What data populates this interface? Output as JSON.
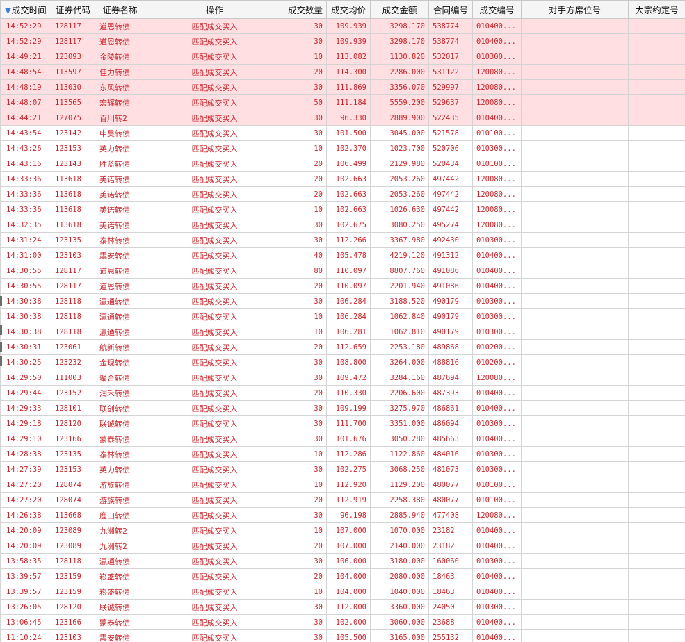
{
  "table": {
    "sorted_column_index": 0,
    "columns": [
      "成交时间",
      "证券代码",
      "证券名称",
      "操作",
      "成交数量",
      "成交均价",
      "成交金额",
      "合同编号",
      "成交编号",
      "对手方席位号",
      "大宗约定号"
    ],
    "rows": [
      {
        "time": "14:52:29",
        "code": "128117",
        "name": "道恩转债",
        "op": "匹配成交买入",
        "qty": "30",
        "price": "109.939",
        "amount": "3298.170",
        "contract": "538774",
        "trade_id": "010400...",
        "counterparty": "",
        "block": "",
        "highlight": true
      },
      {
        "time": "14:52:29",
        "code": "128117",
        "name": "道恩转债",
        "op": "匹配成交买入",
        "qty": "30",
        "price": "109.939",
        "amount": "3298.170",
        "contract": "538774",
        "trade_id": "010400...",
        "counterparty": "",
        "block": "",
        "highlight": true
      },
      {
        "time": "14:49:21",
        "code": "123093",
        "name": "金陵转债",
        "op": "匹配成交买入",
        "qty": "10",
        "price": "113.082",
        "amount": "1130.820",
        "contract": "532017",
        "trade_id": "010300...",
        "counterparty": "",
        "block": "",
        "highlight": true
      },
      {
        "time": "14:48:54",
        "code": "113597",
        "name": "佳力转债",
        "op": "匹配成交买入",
        "qty": "20",
        "price": "114.300",
        "amount": "2286.000",
        "contract": "531122",
        "trade_id": "120080...",
        "counterparty": "",
        "block": "",
        "highlight": true
      },
      {
        "time": "14:48:19",
        "code": "113030",
        "name": "东风转债",
        "op": "匹配成交买入",
        "qty": "30",
        "price": "111.869",
        "amount": "3356.070",
        "contract": "529997",
        "trade_id": "120080...",
        "counterparty": "",
        "block": "",
        "highlight": true
      },
      {
        "time": "14:48:07",
        "code": "113565",
        "name": "宏辉转债",
        "op": "匹配成交买入",
        "qty": "50",
        "price": "111.184",
        "amount": "5559.200",
        "contract": "529637",
        "trade_id": "120080...",
        "counterparty": "",
        "block": "",
        "highlight": true
      },
      {
        "time": "14:44:21",
        "code": "127075",
        "name": "百川转2",
        "op": "匹配成交买入",
        "qty": "30",
        "price": "96.330",
        "amount": "2889.900",
        "contract": "522435",
        "trade_id": "010400...",
        "counterparty": "",
        "block": "",
        "highlight": true
      },
      {
        "time": "14:43:54",
        "code": "123142",
        "name": "申昊转债",
        "op": "匹配成交买入",
        "qty": "30",
        "price": "101.500",
        "amount": "3045.000",
        "contract": "521578",
        "trade_id": "010100...",
        "counterparty": "",
        "block": "",
        "highlight": false
      },
      {
        "time": "14:43:26",
        "code": "123153",
        "name": "英力转债",
        "op": "匹配成交买入",
        "qty": "10",
        "price": "102.370",
        "amount": "1023.700",
        "contract": "520706",
        "trade_id": "010300...",
        "counterparty": "",
        "block": "",
        "highlight": false
      },
      {
        "time": "14:43:16",
        "code": "123143",
        "name": "胜蓝转债",
        "op": "匹配成交买入",
        "qty": "20",
        "price": "106.499",
        "amount": "2129.980",
        "contract": "520434",
        "trade_id": "010100...",
        "counterparty": "",
        "block": "",
        "highlight": false
      },
      {
        "time": "14:33:36",
        "code": "113618",
        "name": "美诺转债",
        "op": "匹配成交买入",
        "qty": "20",
        "price": "102.663",
        "amount": "2053.260",
        "contract": "497442",
        "trade_id": "120080...",
        "counterparty": "",
        "block": "",
        "highlight": false
      },
      {
        "time": "14:33:36",
        "code": "113618",
        "name": "美诺转债",
        "op": "匹配成交买入",
        "qty": "20",
        "price": "102.663",
        "amount": "2053.260",
        "contract": "497442",
        "trade_id": "120080...",
        "counterparty": "",
        "block": "",
        "highlight": false
      },
      {
        "time": "14:33:36",
        "code": "113618",
        "name": "美诺转债",
        "op": "匹配成交买入",
        "qty": "10",
        "price": "102.663",
        "amount": "1026.630",
        "contract": "497442",
        "trade_id": "120080...",
        "counterparty": "",
        "block": "",
        "highlight": false
      },
      {
        "time": "14:32:35",
        "code": "113618",
        "name": "美诺转债",
        "op": "匹配成交买入",
        "qty": "30",
        "price": "102.675",
        "amount": "3080.250",
        "contract": "495274",
        "trade_id": "120080...",
        "counterparty": "",
        "block": "",
        "highlight": false
      },
      {
        "time": "14:31:24",
        "code": "123135",
        "name": "泰林转债",
        "op": "匹配成交买入",
        "qty": "30",
        "price": "112.266",
        "amount": "3367.980",
        "contract": "492430",
        "trade_id": "010300...",
        "counterparty": "",
        "block": "",
        "highlight": false
      },
      {
        "time": "14:31:00",
        "code": "123103",
        "name": "震安转债",
        "op": "匹配成交买入",
        "qty": "40",
        "price": "105.478",
        "amount": "4219.120",
        "contract": "491312",
        "trade_id": "010400...",
        "counterparty": "",
        "block": "",
        "highlight": false
      },
      {
        "time": "14:30:55",
        "code": "128117",
        "name": "道恩转债",
        "op": "匹配成交买入",
        "qty": "80",
        "price": "110.097",
        "amount": "8807.760",
        "contract": "491086",
        "trade_id": "010400...",
        "counterparty": "",
        "block": "",
        "highlight": false
      },
      {
        "time": "14:30:55",
        "code": "128117",
        "name": "道恩转债",
        "op": "匹配成交买入",
        "qty": "20",
        "price": "110.097",
        "amount": "2201.940",
        "contract": "491086",
        "trade_id": "010400...",
        "counterparty": "",
        "block": "",
        "highlight": false
      },
      {
        "time": "14:30:38",
        "code": "128118",
        "name": "瀛通转债",
        "op": "匹配成交买入",
        "qty": "30",
        "price": "106.284",
        "amount": "3188.520",
        "contract": "490179",
        "trade_id": "010300...",
        "counterparty": "",
        "block": "",
        "highlight": false
      },
      {
        "time": "14:30:38",
        "code": "128118",
        "name": "瀛通转债",
        "op": "匹配成交买入",
        "qty": "10",
        "price": "106.284",
        "amount": "1062.840",
        "contract": "490179",
        "trade_id": "010300...",
        "counterparty": "",
        "block": "",
        "highlight": false
      },
      {
        "time": "14:30:38",
        "code": "128118",
        "name": "瀛通转债",
        "op": "匹配成交买入",
        "qty": "10",
        "price": "106.281",
        "amount": "1062.810",
        "contract": "490179",
        "trade_id": "010300...",
        "counterparty": "",
        "block": "",
        "highlight": false
      },
      {
        "time": "14:30:31",
        "code": "123061",
        "name": "航新转债",
        "op": "匹配成交买入",
        "qty": "20",
        "price": "112.659",
        "amount": "2253.180",
        "contract": "489868",
        "trade_id": "010200...",
        "counterparty": "",
        "block": "",
        "highlight": false
      },
      {
        "time": "14:30:25",
        "code": "123232",
        "name": "金现转债",
        "op": "匹配成交买入",
        "qty": "30",
        "price": "108.800",
        "amount": "3264.000",
        "contract": "488816",
        "trade_id": "010200...",
        "counterparty": "",
        "block": "",
        "highlight": false
      },
      {
        "time": "14:29:50",
        "code": "111003",
        "name": "聚合转债",
        "op": "匹配成交买入",
        "qty": "30",
        "price": "109.472",
        "amount": "3284.160",
        "contract": "487694",
        "trade_id": "120080...",
        "counterparty": "",
        "block": "",
        "highlight": false
      },
      {
        "time": "14:29:44",
        "code": "123152",
        "name": "润禾转债",
        "op": "匹配成交买入",
        "qty": "20",
        "price": "110.330",
        "amount": "2206.600",
        "contract": "487393",
        "trade_id": "010400...",
        "counterparty": "",
        "block": "",
        "highlight": false
      },
      {
        "time": "14:29:33",
        "code": "128101",
        "name": "联创转债",
        "op": "匹配成交买入",
        "qty": "30",
        "price": "109.199",
        "amount": "3275.970",
        "contract": "486861",
        "trade_id": "010400...",
        "counterparty": "",
        "block": "",
        "highlight": false
      },
      {
        "time": "14:29:18",
        "code": "128120",
        "name": "联诚转债",
        "op": "匹配成交买入",
        "qty": "30",
        "price": "111.700",
        "amount": "3351.000",
        "contract": "486094",
        "trade_id": "010300...",
        "counterparty": "",
        "block": "",
        "highlight": false
      },
      {
        "time": "14:29:10",
        "code": "123166",
        "name": "蒙泰转债",
        "op": "匹配成交买入",
        "qty": "30",
        "price": "101.676",
        "amount": "3050.280",
        "contract": "485663",
        "trade_id": "010400...",
        "counterparty": "",
        "block": "",
        "highlight": false
      },
      {
        "time": "14:28:38",
        "code": "123135",
        "name": "泰林转债",
        "op": "匹配成交买入",
        "qty": "10",
        "price": "112.286",
        "amount": "1122.860",
        "contract": "484016",
        "trade_id": "010300...",
        "counterparty": "",
        "block": "",
        "highlight": false
      },
      {
        "time": "14:27:39",
        "code": "123153",
        "name": "英力转债",
        "op": "匹配成交买入",
        "qty": "30",
        "price": "102.275",
        "amount": "3068.250",
        "contract": "481073",
        "trade_id": "010300...",
        "counterparty": "",
        "block": "",
        "highlight": false
      },
      {
        "time": "14:27:20",
        "code": "128074",
        "name": "游族转债",
        "op": "匹配成交买入",
        "qty": "10",
        "price": "112.920",
        "amount": "1129.200",
        "contract": "480077",
        "trade_id": "010100...",
        "counterparty": "",
        "block": "",
        "highlight": false
      },
      {
        "time": "14:27:20",
        "code": "128074",
        "name": "游族转债",
        "op": "匹配成交买入",
        "qty": "20",
        "price": "112.919",
        "amount": "2258.380",
        "contract": "480077",
        "trade_id": "010100...",
        "counterparty": "",
        "block": "",
        "highlight": false
      },
      {
        "time": "14:26:38",
        "code": "113668",
        "name": "鹿山转债",
        "op": "匹配成交买入",
        "qty": "30",
        "price": "96.198",
        "amount": "2885.940",
        "contract": "477408",
        "trade_id": "120080...",
        "counterparty": "",
        "block": "",
        "highlight": false
      },
      {
        "time": "14:20:09",
        "code": "123089",
        "name": "九洲转2",
        "op": "匹配成交买入",
        "qty": "10",
        "price": "107.000",
        "amount": "1070.000",
        "contract": "23182",
        "trade_id": "010400...",
        "counterparty": "",
        "block": "",
        "highlight": false
      },
      {
        "time": "14:20:09",
        "code": "123089",
        "name": "九洲转2",
        "op": "匹配成交买入",
        "qty": "20",
        "price": "107.000",
        "amount": "2140.000",
        "contract": "23182",
        "trade_id": "010400...",
        "counterparty": "",
        "block": "",
        "highlight": false
      },
      {
        "time": "13:58:35",
        "code": "128118",
        "name": "瀛通转债",
        "op": "匹配成交买入",
        "qty": "30",
        "price": "106.000",
        "amount": "3180.000",
        "contract": "160060",
        "trade_id": "010300...",
        "counterparty": "",
        "block": "",
        "highlight": false
      },
      {
        "time": "13:39:57",
        "code": "123159",
        "name": "崧盛转债",
        "op": "匹配成交买入",
        "qty": "20",
        "price": "104.000",
        "amount": "2080.000",
        "contract": "18463",
        "trade_id": "010400...",
        "counterparty": "",
        "block": "",
        "highlight": false
      },
      {
        "time": "13:39:57",
        "code": "123159",
        "name": "崧盛转债",
        "op": "匹配成交买入",
        "qty": "10",
        "price": "104.000",
        "amount": "1040.000",
        "contract": "18463",
        "trade_id": "010400...",
        "counterparty": "",
        "block": "",
        "highlight": false
      },
      {
        "time": "13:26:05",
        "code": "128120",
        "name": "联诚转债",
        "op": "匹配成交买入",
        "qty": "30",
        "price": "112.000",
        "amount": "3360.000",
        "contract": "24050",
        "trade_id": "010300...",
        "counterparty": "",
        "block": "",
        "highlight": false
      },
      {
        "time": "13:06:45",
        "code": "123166",
        "name": "蒙泰转债",
        "op": "匹配成交买入",
        "qty": "30",
        "price": "102.000",
        "amount": "3060.000",
        "contract": "23688",
        "trade_id": "010400...",
        "counterparty": "",
        "block": "",
        "highlight": false
      },
      {
        "time": "11:10:24",
        "code": "123103",
        "name": "震安转债",
        "op": "匹配成交买入",
        "qty": "30",
        "price": "105.500",
        "amount": "3165.000",
        "contract": "255132",
        "trade_id": "010400...",
        "counterparty": "",
        "block": "",
        "highlight": false
      }
    ]
  },
  "colors": {
    "text": "#c8282d",
    "highlight_row": "#ffdfe2",
    "header_bg": "#f5f5f5",
    "sort_arrow": "#3a7fd5"
  },
  "icons": {
    "sort": "sort-down-icon"
  }
}
